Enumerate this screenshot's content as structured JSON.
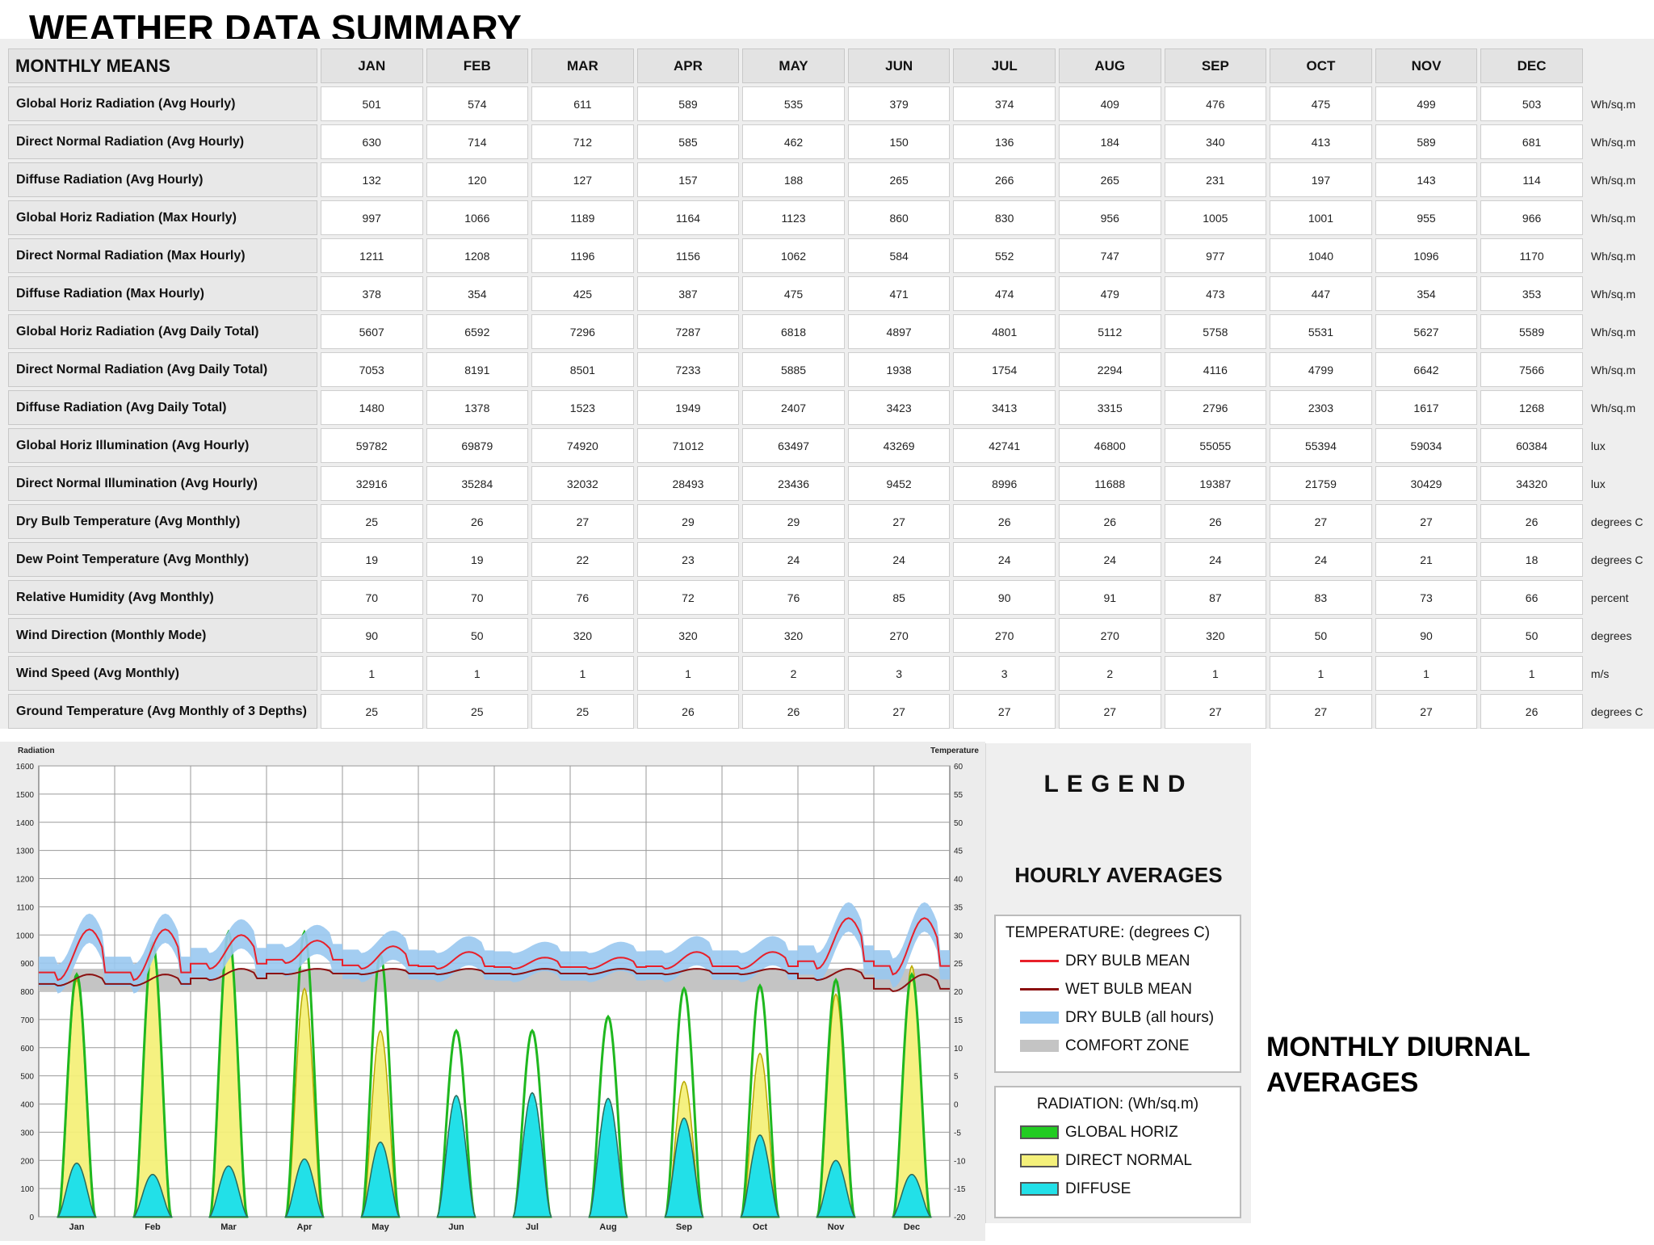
{
  "page_title": "WEATHER DATA SUMMARY",
  "side_label_line1": "MONTHLY DIURNAL",
  "side_label_line2": "AVERAGES",
  "chart_data": [
    {
      "type": "table",
      "corner_header": "MONTHLY MEANS",
      "columns": [
        "JAN",
        "FEB",
        "MAR",
        "APR",
        "MAY",
        "JUN",
        "JUL",
        "AUG",
        "SEP",
        "OCT",
        "NOV",
        "DEC"
      ],
      "rows": [
        {
          "label": "Global Horiz Radiation (Avg Hourly)",
          "values": [
            501,
            574,
            611,
            589,
            535,
            379,
            374,
            409,
            476,
            475,
            499,
            503
          ],
          "unit": "Wh/sq.m"
        },
        {
          "label": "Direct Normal Radiation (Avg Hourly)",
          "values": [
            630,
            714,
            712,
            585,
            462,
            150,
            136,
            184,
            340,
            413,
            589,
            681
          ],
          "unit": "Wh/sq.m"
        },
        {
          "label": "Diffuse Radiation (Avg Hourly)",
          "values": [
            132,
            120,
            127,
            157,
            188,
            265,
            266,
            265,
            231,
            197,
            143,
            114
          ],
          "unit": "Wh/sq.m"
        },
        {
          "label": "Global Horiz Radiation (Max Hourly)",
          "values": [
            997,
            1066,
            1189,
            1164,
            1123,
            860,
            830,
            956,
            1005,
            1001,
            955,
            966
          ],
          "unit": "Wh/sq.m"
        },
        {
          "label": "Direct Normal Radiation (Max Hourly)",
          "values": [
            1211,
            1208,
            1196,
            1156,
            1062,
            584,
            552,
            747,
            977,
            1040,
            1096,
            1170
          ],
          "unit": "Wh/sq.m"
        },
        {
          "label": "Diffuse Radiation (Max Hourly)",
          "values": [
            378,
            354,
            425,
            387,
            475,
            471,
            474,
            479,
            473,
            447,
            354,
            353
          ],
          "unit": "Wh/sq.m"
        },
        {
          "label": "Global Horiz Radiation (Avg Daily Total)",
          "values": [
            5607,
            6592,
            7296,
            7287,
            6818,
            4897,
            4801,
            5112,
            5758,
            5531,
            5627,
            5589
          ],
          "unit": "Wh/sq.m"
        },
        {
          "label": "Direct Normal Radiation (Avg Daily Total)",
          "values": [
            7053,
            8191,
            8501,
            7233,
            5885,
            1938,
            1754,
            2294,
            4116,
            4799,
            6642,
            7566
          ],
          "unit": "Wh/sq.m"
        },
        {
          "label": "Diffuse Radiation (Avg Daily Total)",
          "values": [
            1480,
            1378,
            1523,
            1949,
            2407,
            3423,
            3413,
            3315,
            2796,
            2303,
            1617,
            1268
          ],
          "unit": "Wh/sq.m"
        },
        {
          "label": "Global Horiz Illumination (Avg Hourly)",
          "values": [
            59782,
            69879,
            74920,
            71012,
            63497,
            43269,
            42741,
            46800,
            55055,
            55394,
            59034,
            60384
          ],
          "unit": "lux"
        },
        {
          "label": "Direct Normal Illumination (Avg Hourly)",
          "values": [
            32916,
            35284,
            32032,
            28493,
            23436,
            9452,
            8996,
            11688,
            19387,
            21759,
            30429,
            34320
          ],
          "unit": "lux"
        },
        {
          "label": "Dry Bulb Temperature (Avg Monthly)",
          "values": [
            25,
            26,
            27,
            29,
            29,
            27,
            26,
            26,
            26,
            27,
            27,
            26
          ],
          "unit": "degrees C"
        },
        {
          "label": "Dew Point Temperature (Avg Monthly)",
          "values": [
            19,
            19,
            22,
            23,
            24,
            24,
            24,
            24,
            24,
            24,
            21,
            18
          ],
          "unit": "degrees C"
        },
        {
          "label": "Relative Humidity (Avg Monthly)",
          "values": [
            70,
            70,
            76,
            72,
            76,
            85,
            90,
            91,
            87,
            83,
            73,
            66
          ],
          "unit": "percent"
        },
        {
          "label": "Wind Direction (Monthly Mode)",
          "values": [
            90,
            50,
            320,
            320,
            320,
            270,
            270,
            270,
            320,
            50,
            90,
            50
          ],
          "unit": "degrees"
        },
        {
          "label": "Wind Speed (Avg Monthly)",
          "values": [
            1,
            1,
            1,
            1,
            2,
            3,
            3,
            2,
            1,
            1,
            1,
            1
          ],
          "unit": "m/s"
        },
        {
          "label": "Ground Temperature (Avg Monthly of 3 Depths)",
          "values": [
            25,
            25,
            25,
            26,
            26,
            27,
            27,
            27,
            27,
            27,
            27,
            26
          ],
          "unit": "degrees C"
        }
      ]
    },
    {
      "type": "area",
      "left_axis_label": "Radiation",
      "right_axis_label": "Temperature",
      "ylim_left": [
        0,
        1600
      ],
      "ylim_right": [
        -20,
        60
      ],
      "left_ticks": [
        0,
        100,
        200,
        300,
        400,
        500,
        600,
        700,
        800,
        900,
        1000,
        1100,
        1200,
        1300,
        1400,
        1500,
        1600
      ],
      "right_ticks": [
        -20,
        -15,
        -10,
        -5,
        0,
        5,
        10,
        15,
        20,
        25,
        30,
        35,
        40,
        45,
        50,
        55,
        60
      ],
      "months": [
        "Jan",
        "Feb",
        "Mar",
        "Apr",
        "May",
        "Jun",
        "Jul",
        "Aug",
        "Sep",
        "Oct",
        "Nov",
        "Dec"
      ],
      "grid": true,
      "comfort_zone_c": [
        20,
        24
      ],
      "series": [
        {
          "name": "GLOBAL HORIZ",
          "unit": "Wh/sq.m",
          "peak_values": [
            860,
            970,
            1010,
            1010,
            930,
            660,
            660,
            710,
            810,
            820,
            840,
            860
          ]
        },
        {
          "name": "DIRECT NORMAL",
          "unit": "Wh/sq.m",
          "peak_values": [
            840,
            960,
            1000,
            810,
            660,
            370,
            420,
            400,
            480,
            580,
            790,
            890
          ]
        },
        {
          "name": "DIFFUSE",
          "unit": "Wh/sq.m",
          "peak_values": [
            190,
            150,
            180,
            205,
            265,
            430,
            440,
            420,
            350,
            290,
            200,
            150
          ]
        },
        {
          "name": "DRY BULB MEAN",
          "unit": "degrees C",
          "min_values": [
            22,
            22,
            24,
            25,
            24,
            24,
            24,
            24,
            24,
            24,
            24,
            23
          ],
          "max_values": [
            31,
            31,
            30,
            29,
            28,
            27,
            26,
            26,
            27,
            27,
            33,
            33
          ]
        },
        {
          "name": "WET BULB MEAN",
          "unit": "degrees C",
          "min_values": [
            21,
            21,
            22,
            23,
            23,
            23,
            23,
            23,
            23,
            23,
            22,
            20
          ],
          "max_values": [
            23,
            23,
            24,
            24,
            24,
            24,
            24,
            24,
            24,
            24,
            24,
            23
          ]
        }
      ],
      "legend": {
        "title": "LEGEND",
        "subtitle": "HOURLY AVERAGES",
        "temperature_header": "TEMPERATURE: (degrees C)",
        "temperature_items": [
          {
            "label": "DRY BULB MEAN",
            "color": "#e8202a"
          },
          {
            "label": "WET BULB MEAN",
            "color": "#8b1010"
          },
          {
            "label": "DRY BULB (all hours)",
            "color": "#99c8f0"
          },
          {
            "label": "COMFORT ZONE",
            "color": "#c4c4c4"
          }
        ],
        "radiation_header": "RADIATION: (Wh/sq.m)",
        "radiation_items": [
          {
            "label": "GLOBAL HORIZ",
            "color": "#22cc22"
          },
          {
            "label": "DIRECT NORMAL",
            "color": "#f4f07a"
          },
          {
            "label": "DIFFUSE",
            "color": "#22e0e8"
          }
        ]
      }
    }
  ]
}
